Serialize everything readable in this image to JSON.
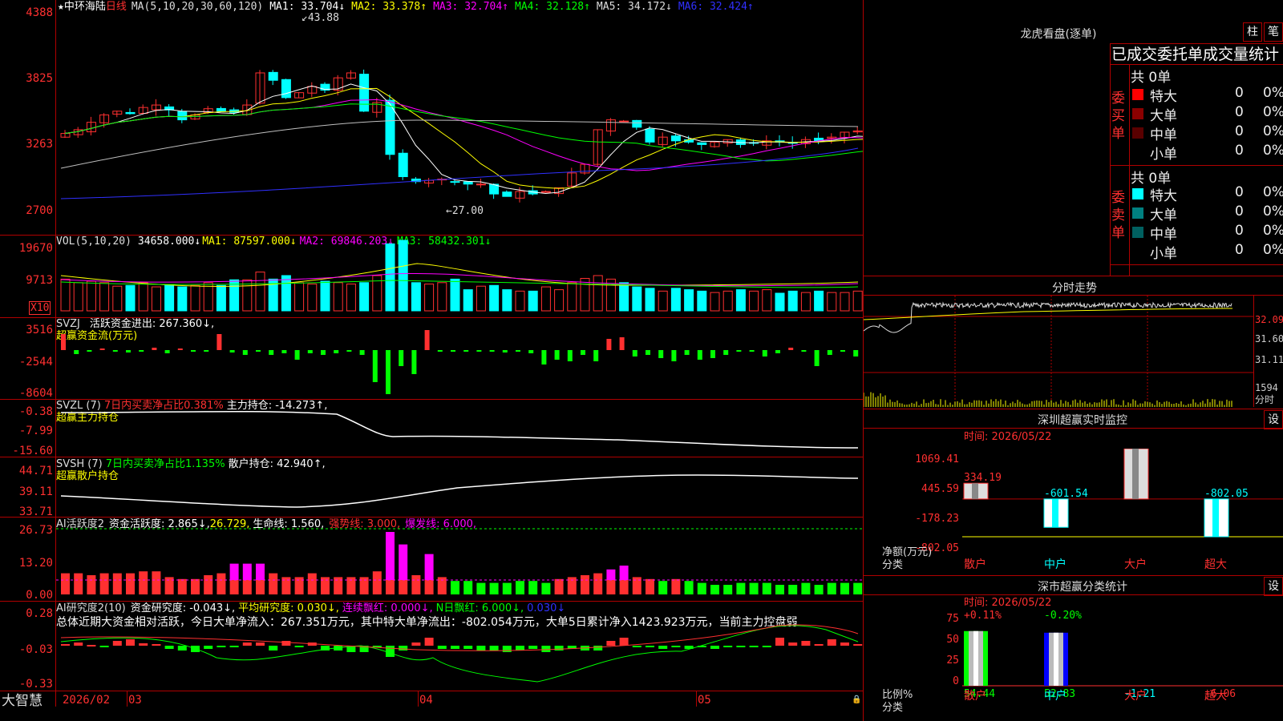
{
  "stock": {
    "star": "★",
    "name": "中环海陆",
    "period": "日线",
    "ma_title": "MA(5,10,20,30,60,120)",
    "ma1": "MA1: 33.704↓",
    "ma2": "MA2: 33.378↑",
    "ma3": "MA3: 32.704↑",
    "ma4": "MA4: 32.128↑",
    "ma5": "MA5: 34.172↓",
    "ma6": "MA6: 32.424↑",
    "high_label": "43.88",
    "low_label": "27.00",
    "axis": [
      "4388",
      "3825",
      "3263",
      "2700"
    ]
  },
  "vol": {
    "title": "VOL(5,10,20)",
    "v": "34658.000↓",
    "ma1": "MA1: 87597.000↓",
    "ma2": "MA2: 69846.203↓",
    "ma3": "MA3: 58432.301↓",
    "axis": [
      "19670",
      "9713"
    ],
    "unit": "X10"
  },
  "svzj": {
    "title": "SVZJ",
    "line1": "活跃资金进出: 267.360↓,",
    "line2": "超赢资金流(万元)",
    "axis": [
      "3516",
      "-2544",
      "-8604"
    ]
  },
  "svzl": {
    "title": "SVZL (7)",
    "pct": "7日内买卖净占比0.381%",
    "main": "主力持仓: -14.273↑,",
    "line2": "超赢主力持仓",
    "axis": [
      "-0.38",
      "-7.99",
      "-15.60"
    ]
  },
  "svsh": {
    "title": "SVSH (7)",
    "pct": "7日内买卖净占比1.135%",
    "main": "散户持仓: 42.940↑,",
    "line2": "超赢散户持仓",
    "axis": [
      "44.71",
      "39.11",
      "33.71"
    ]
  },
  "ai1": {
    "title": "AI活跃度2",
    "a": "资金活跃度: 2.865↓,",
    "b": "26.729,",
    "c": "生命线: 1.560,",
    "d": "强势线: 3.000,",
    "e": "爆发线: 6.000,",
    "axis": [
      "26.73",
      "13.20",
      "0.00"
    ]
  },
  "ai2": {
    "title": "AI研究度2(10)",
    "a": "资金研究度: -0.043↓,",
    "b": "平均研究度: 0.030↓,",
    "c": "连续飘红: 0.000↓,",
    "d": "N日飘红: 6.000↓,",
    "e": "0.030↓",
    "summary": "总体近期大资金相对活跃，今日大单净流入：267.351万元，其中特大单净流出：-802.054万元，大单5日累计净入1423.923万元，当前主力控盘弱",
    "axis": [
      "0.28",
      "-0.03",
      "-0.33"
    ]
  },
  "bottom": {
    "brand": "大智慧",
    "date1": "2026/02",
    "m3": "03",
    "m4": "04",
    "m5": "05"
  },
  "lhb": {
    "title": "龙虎看盘(逐单)",
    "btn1": "柱",
    "btn2": "笔",
    "tabs": "已成交委托单成交量统计",
    "buy_label": [
      "委",
      "买",
      "单"
    ],
    "sell_label": [
      "委",
      "卖",
      "单"
    ],
    "buy_total": "共 0单",
    "sell_total": "共 0单",
    "buy_rows": [
      {
        "name": "特大",
        "count": "0",
        "pct": "0%",
        "color": "#ff0000"
      },
      {
        "name": "大单",
        "count": "0",
        "pct": "0%",
        "color": "#8b0000"
      },
      {
        "name": "中单",
        "count": "0",
        "pct": "0%",
        "color": "#5a0000"
      },
      {
        "name": "小单",
        "count": "0",
        "pct": "0%",
        "color": "#000000"
      }
    ],
    "sell_rows": [
      {
        "name": "特大",
        "count": "0",
        "pct": "0%",
        "color": "#00ffff"
      },
      {
        "name": "大单",
        "count": "0",
        "pct": "0%",
        "color": "#008080"
      },
      {
        "name": "中单",
        "count": "0",
        "pct": "0%",
        "color": "#006060"
      },
      {
        "name": "小单",
        "count": "0",
        "pct": "0%",
        "color": "#000000"
      }
    ]
  },
  "fenshi": {
    "title": "分时走势",
    "price_axis": [
      "32.09",
      "31.60",
      "31.11"
    ],
    "vol_axis": [
      "1594",
      "分时"
    ]
  },
  "sz_monitor": {
    "title": "深圳超赢实时监控",
    "btn": "设",
    "time": "时间: 2026/05/22",
    "axis": [
      "1069.41",
      "445.59",
      "-178.23",
      "-802.05"
    ],
    "ylabel1": "净额(万元)",
    "ylabel2": "分类",
    "categories": [
      "散户",
      "中户",
      "大户",
      "超大"
    ],
    "values_text": [
      "334.19",
      "-601.54",
      "1069.41",
      "-802.05"
    ],
    "values": [
      334.19,
      -601.54,
      1069.41,
      -802.05
    ]
  },
  "sz_class": {
    "title": "深市超赢分类统计",
    "btn": "设",
    "time": "时间: 2026/05/22",
    "axis": [
      "75",
      "50",
      "25",
      "0"
    ],
    "ylabel1": "比例%",
    "ylabel2": "分类",
    "categories": [
      "散户",
      "中户",
      "大户",
      "超大"
    ],
    "top_text": [
      "+0.11%",
      "-0.20%",
      "",
      ""
    ],
    "bottom_text": [
      "54.44",
      "52.83",
      "-1.21",
      "-6.06"
    ],
    "values": [
      54.44,
      52.83,
      -1.21,
      -6.06
    ]
  },
  "colors": {
    "up": "#ff3030",
    "down": "#00ffff",
    "border": "#b00000",
    "ma1": "#ffffff",
    "ma2": "#ffff00",
    "ma3": "#ff00ff",
    "ma4": "#00ff00",
    "ma5": "#c0c0c0",
    "ma6": "#3030ff"
  }
}
